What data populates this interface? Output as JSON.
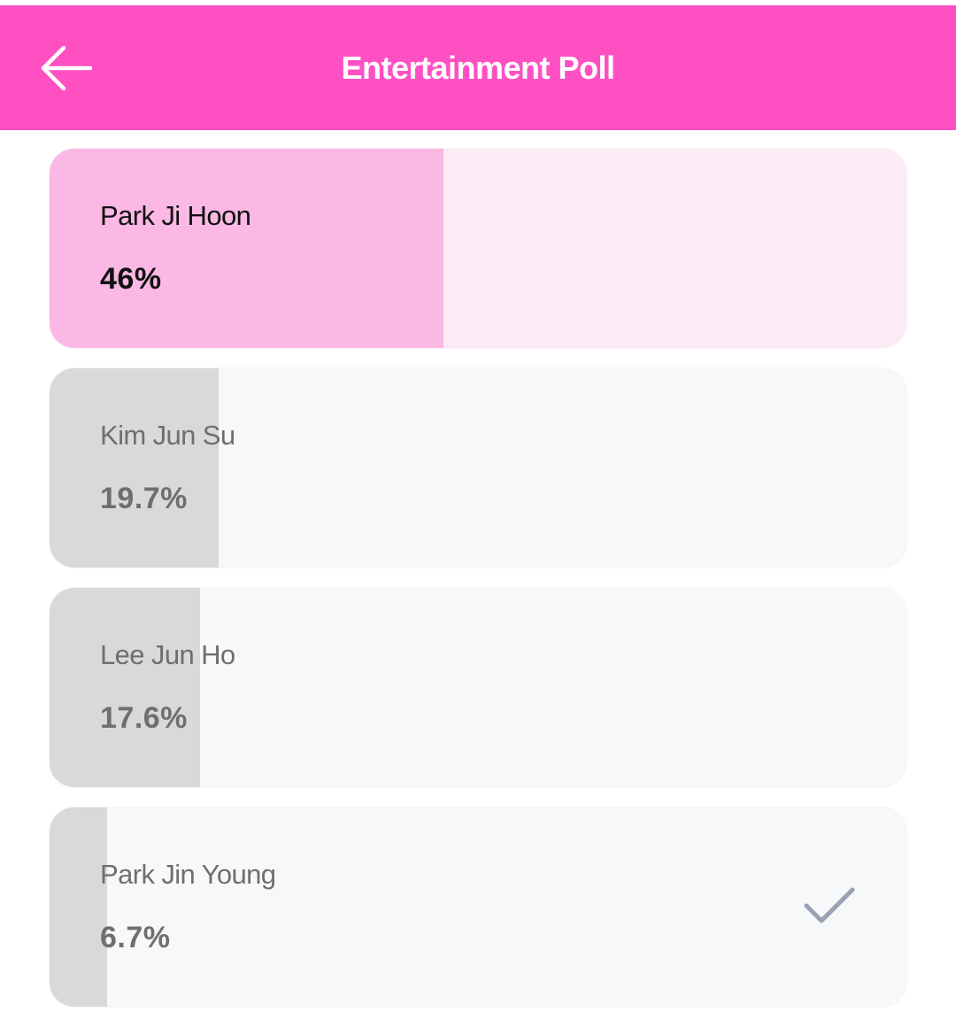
{
  "colors": {
    "header_bg": "#ff50c3",
    "winner_fill": "#fbb8e4",
    "winner_track": "#feeaf6",
    "other_fill": "#d9d9d9",
    "other_track": "#f7f8fa",
    "check_color": "#9aa1b3"
  },
  "header": {
    "title": "Entertainment Poll",
    "back_icon": "arrow-left-icon"
  },
  "options": [
    {
      "name": "Park Ji Hoon",
      "percent_label": "46%",
      "percent": 46,
      "leading": true,
      "selected": false
    },
    {
      "name": "Kim Jun Su",
      "percent_label": "19.7%",
      "percent": 19.7,
      "leading": false,
      "selected": false
    },
    {
      "name": "Lee Jun Ho",
      "percent_label": "17.6%",
      "percent": 17.6,
      "leading": false,
      "selected": false
    },
    {
      "name": "Park Jin Young",
      "percent_label": "6.7%",
      "percent": 6.7,
      "leading": false,
      "selected": true
    }
  ],
  "selected_icon": "checkmark-icon"
}
